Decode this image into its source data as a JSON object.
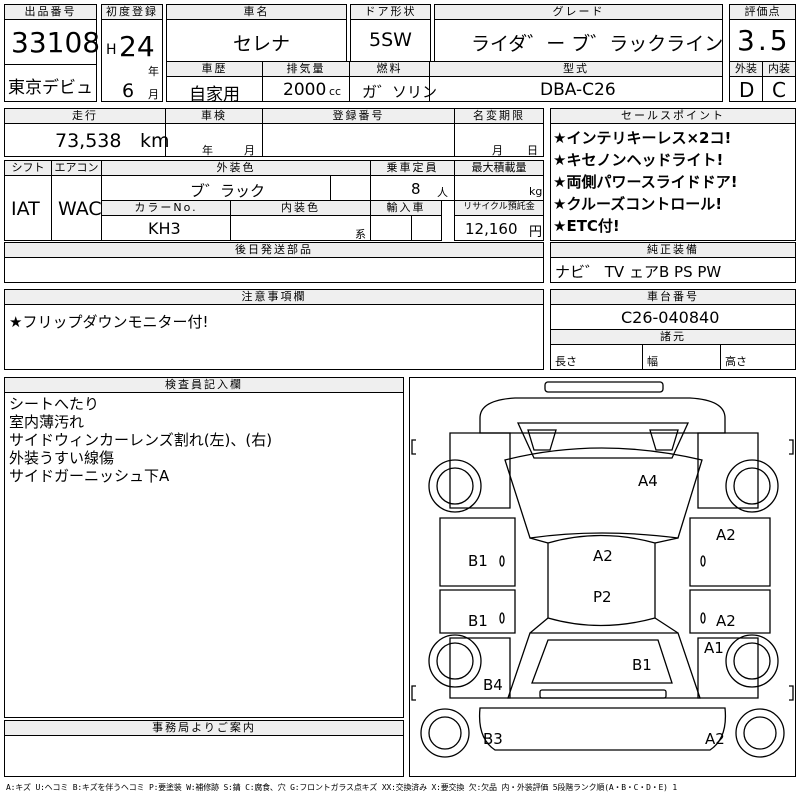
{
  "header": {
    "lot_no_label": "出品番号",
    "lot_no": "33108",
    "first_reg_label": "初度登録",
    "era": "H",
    "year": "24",
    "year_unit": "年",
    "month": "6",
    "month_unit": "月",
    "debut": "東京デビュ",
    "car_name_label": "車名",
    "car_name": "セレナ",
    "door_label": "ドア形状",
    "door": "5SW",
    "grade_label": "グレード",
    "grade": "ライダ゛ー ブ゛ラックライン",
    "score_label": "評価点",
    "score": "3.5",
    "history_label": "車歴",
    "history": "自家用",
    "displacement_label": "排気量",
    "displacement": "2000",
    "displacement_unit": "cc",
    "fuel_label": "燃料",
    "fuel": "ガ゛ソリン",
    "model_label": "型式",
    "model": "DBA-C26",
    "exterior_label": "外装",
    "exterior_grade": "D",
    "interior_label": "内装",
    "interior_grade": "C"
  },
  "row2": {
    "mileage_label": "走行",
    "mileage": "73,538",
    "mileage_unit": "km",
    "inspection_label": "車検",
    "inspection_year_unit": "年",
    "inspection_month_unit": "月",
    "reg_no_label": "登録番号",
    "name_change_label": "名変期限",
    "name_change_month_unit": "月",
    "name_change_day_unit": "日",
    "sales_points_label": "セールスポイント",
    "sales_points": [
      "★インテリキーレス×2コ!",
      "★キセノンヘッドライト!",
      "★両側パワースライドドア!",
      "★クルーズコントロール!",
      "★ETC付!"
    ]
  },
  "spec": {
    "shift_label": "シフト",
    "shift": "IAT",
    "ac_label": "エアコン",
    "ac": "WAC",
    "ext_color_label": "外装色",
    "ext_color": "ブ゛ラック",
    "capacity_label": "乗車定員",
    "capacity": "8",
    "capacity_unit": "人",
    "max_load_label": "最大積載量",
    "max_load_unit": "kg",
    "color_no_label": "カラーNo.",
    "color_no": "KH3",
    "int_color_label": "内装色",
    "int_color_unit": "系",
    "import_label": "輸入車",
    "recycle_label": "リサイクル預託金",
    "recycle": "12,160",
    "recycle_unit": "円",
    "later_parts_label": "後日発送部品",
    "genuine_label": "純正装備",
    "genuine": "ナビ゛ TV ェアB PS PW"
  },
  "notes": {
    "caution_label": "注意事項欄",
    "caution": "★フリップダウンモニター付!",
    "chassis_label": "車台番号",
    "chassis": "C26-040840",
    "dims_label": "諸元",
    "length_label": "長さ",
    "width_label": "幅",
    "height_label": "高さ"
  },
  "inspector": {
    "label": "検査員記入欄",
    "lines": [
      "シートへたり",
      "室内薄汚れ",
      "サイドウィンカーレンズ割れ(左)、(右)",
      "外装うすい線傷",
      "サイドガーニッシュ下A"
    ]
  },
  "office": {
    "label": "事務局よりご案内"
  },
  "diagram_marks": [
    "A4",
    "A2",
    "B1",
    "A2",
    "P2",
    "B1",
    "A2",
    "A1",
    "B1",
    "B4",
    "B3",
    "A2"
  ],
  "legend": "A:キズ U:ヘコミ B:キズを伴うヘコミ P:要塗装 W:補修跡 S:錆 C:腐食、穴 G:フロントガラス点キズ XX:交換済み X:要交換 欠:欠品 内・外装評価 5段階ランク順(A・B・C・D・E) 1"
}
